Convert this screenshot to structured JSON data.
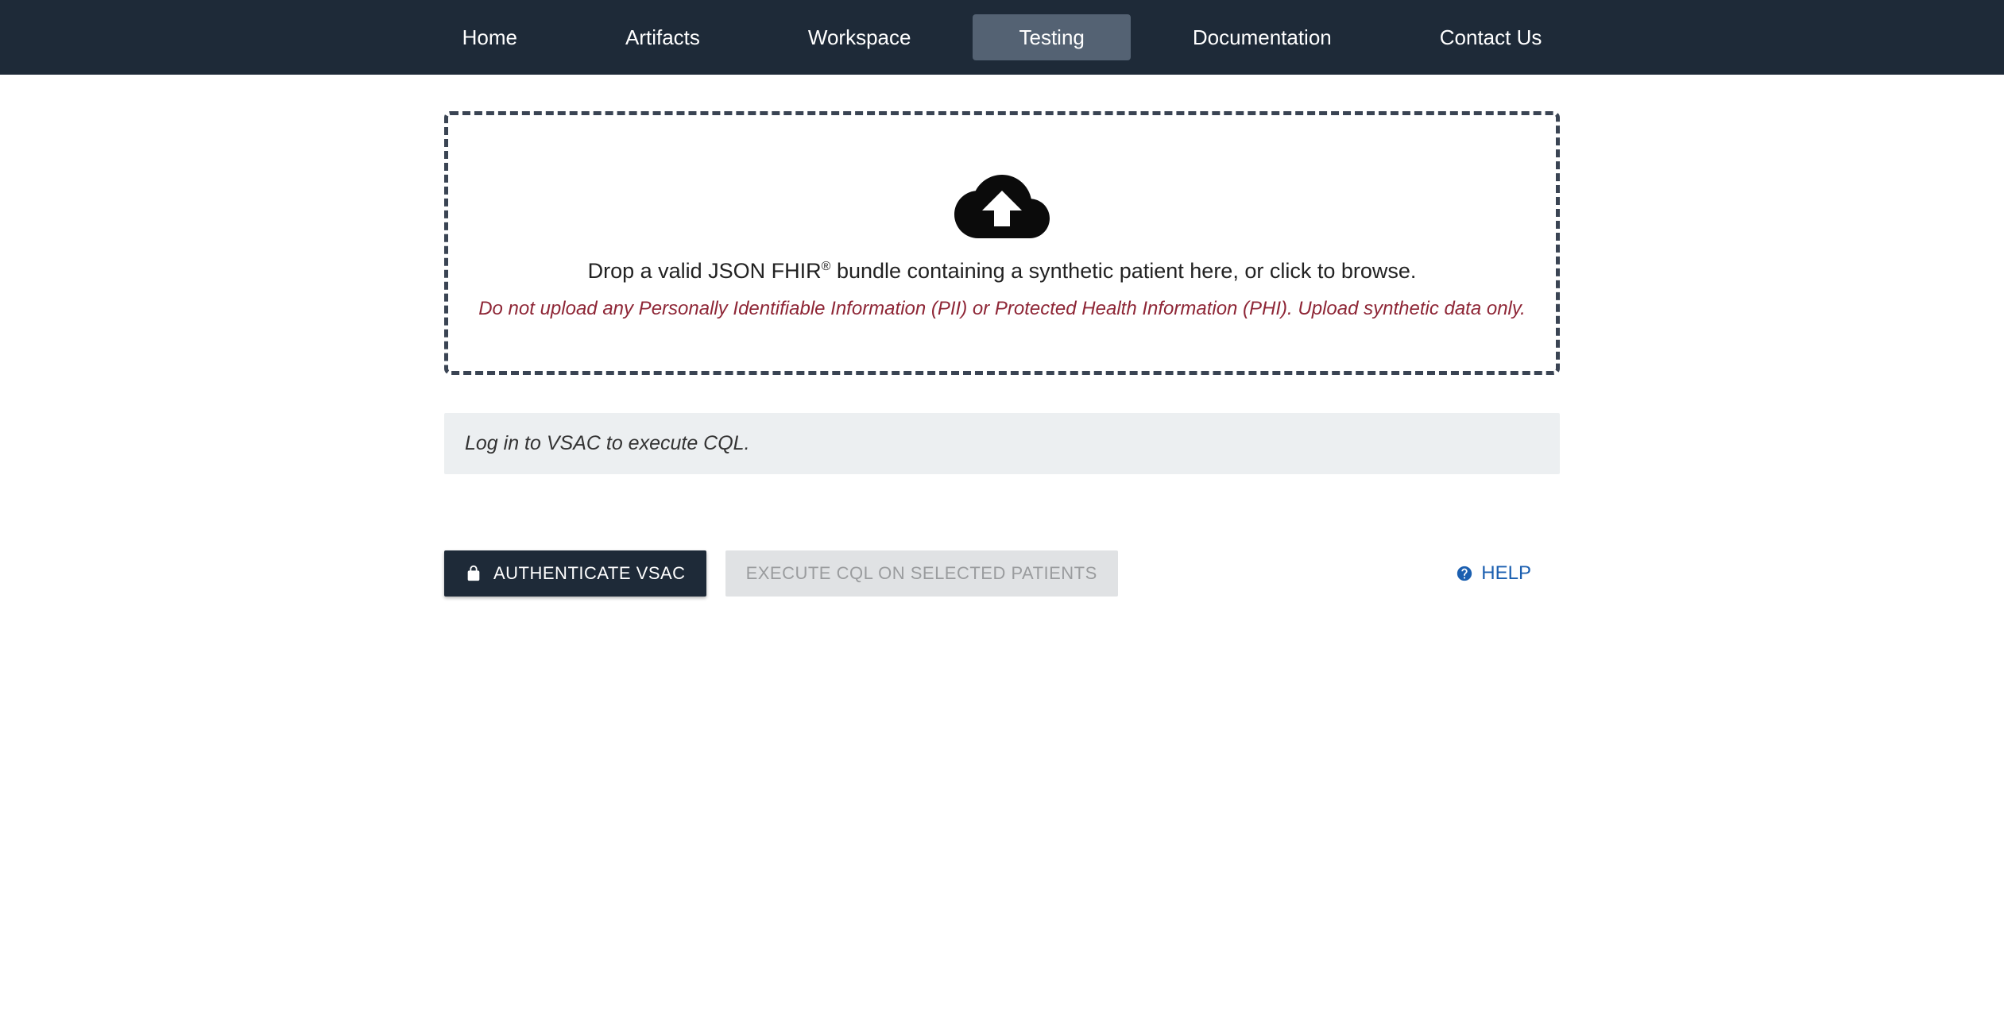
{
  "nav": {
    "items": [
      {
        "label": "Home"
      },
      {
        "label": "Artifacts"
      },
      {
        "label": "Workspace"
      },
      {
        "label": "Testing"
      },
      {
        "label": "Documentation"
      },
      {
        "label": "Contact Us"
      }
    ],
    "activeIndex": 3
  },
  "dropzone": {
    "main_prefix": "Drop a valid JSON FHIR",
    "registered_mark": "®",
    "main_suffix": " bundle containing a synthetic patient here, or click to browse.",
    "warning": "Do not upload any Personally Identifiable Information (PII) or Protected Health Information (PHI). Upload synthetic data only."
  },
  "banner": {
    "message": "Log in to VSAC to execute CQL."
  },
  "actions": {
    "authenticate_label": "AUTHENTICATE VSAC",
    "execute_label": "EXECUTE CQL ON SELECTED PATIENTS",
    "help_label": "HELP"
  }
}
